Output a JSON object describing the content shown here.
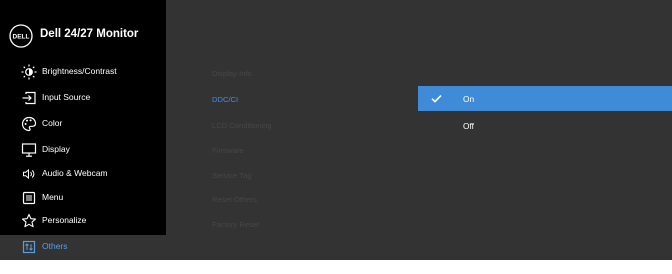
{
  "header": {
    "title": "Dell 24/27 Monitor",
    "logo_text": "DELL"
  },
  "menu": [
    {
      "label": "Brightness/Contrast",
      "icon": "brightness-icon",
      "active": false
    },
    {
      "label": "Input Source",
      "icon": "input-source-icon",
      "active": false
    },
    {
      "label": "Color",
      "icon": "color-palette-icon",
      "active": false
    },
    {
      "label": "Display",
      "icon": "display-icon",
      "active": false
    },
    {
      "label": "Audio & Webcam",
      "icon": "audio-icon",
      "active": false
    },
    {
      "label": "Menu",
      "icon": "menu-icon",
      "active": false
    },
    {
      "label": "Personalize",
      "icon": "star-icon",
      "active": false
    },
    {
      "label": "Others",
      "icon": "others-icon",
      "active": true
    }
  ],
  "submenu": [
    {
      "label": "Display Info",
      "active": false
    },
    {
      "label": "DDC/CI",
      "active": true
    },
    {
      "label": "LCD Conditioning",
      "active": false
    },
    {
      "label": "Firmware",
      "active": false
    },
    {
      "label": "Service Tag",
      "active": false
    },
    {
      "label": "Reset Others",
      "active": false
    },
    {
      "label": "Factory Reset",
      "active": false
    }
  ],
  "options": [
    {
      "label": "On",
      "selected": true
    },
    {
      "label": "Off",
      "selected": false
    }
  ],
  "colors": {
    "accent": "#3f8bd8",
    "sidebar_bg": "#000000",
    "panel_bg": "#333333",
    "active_text": "#5a9ee0"
  }
}
